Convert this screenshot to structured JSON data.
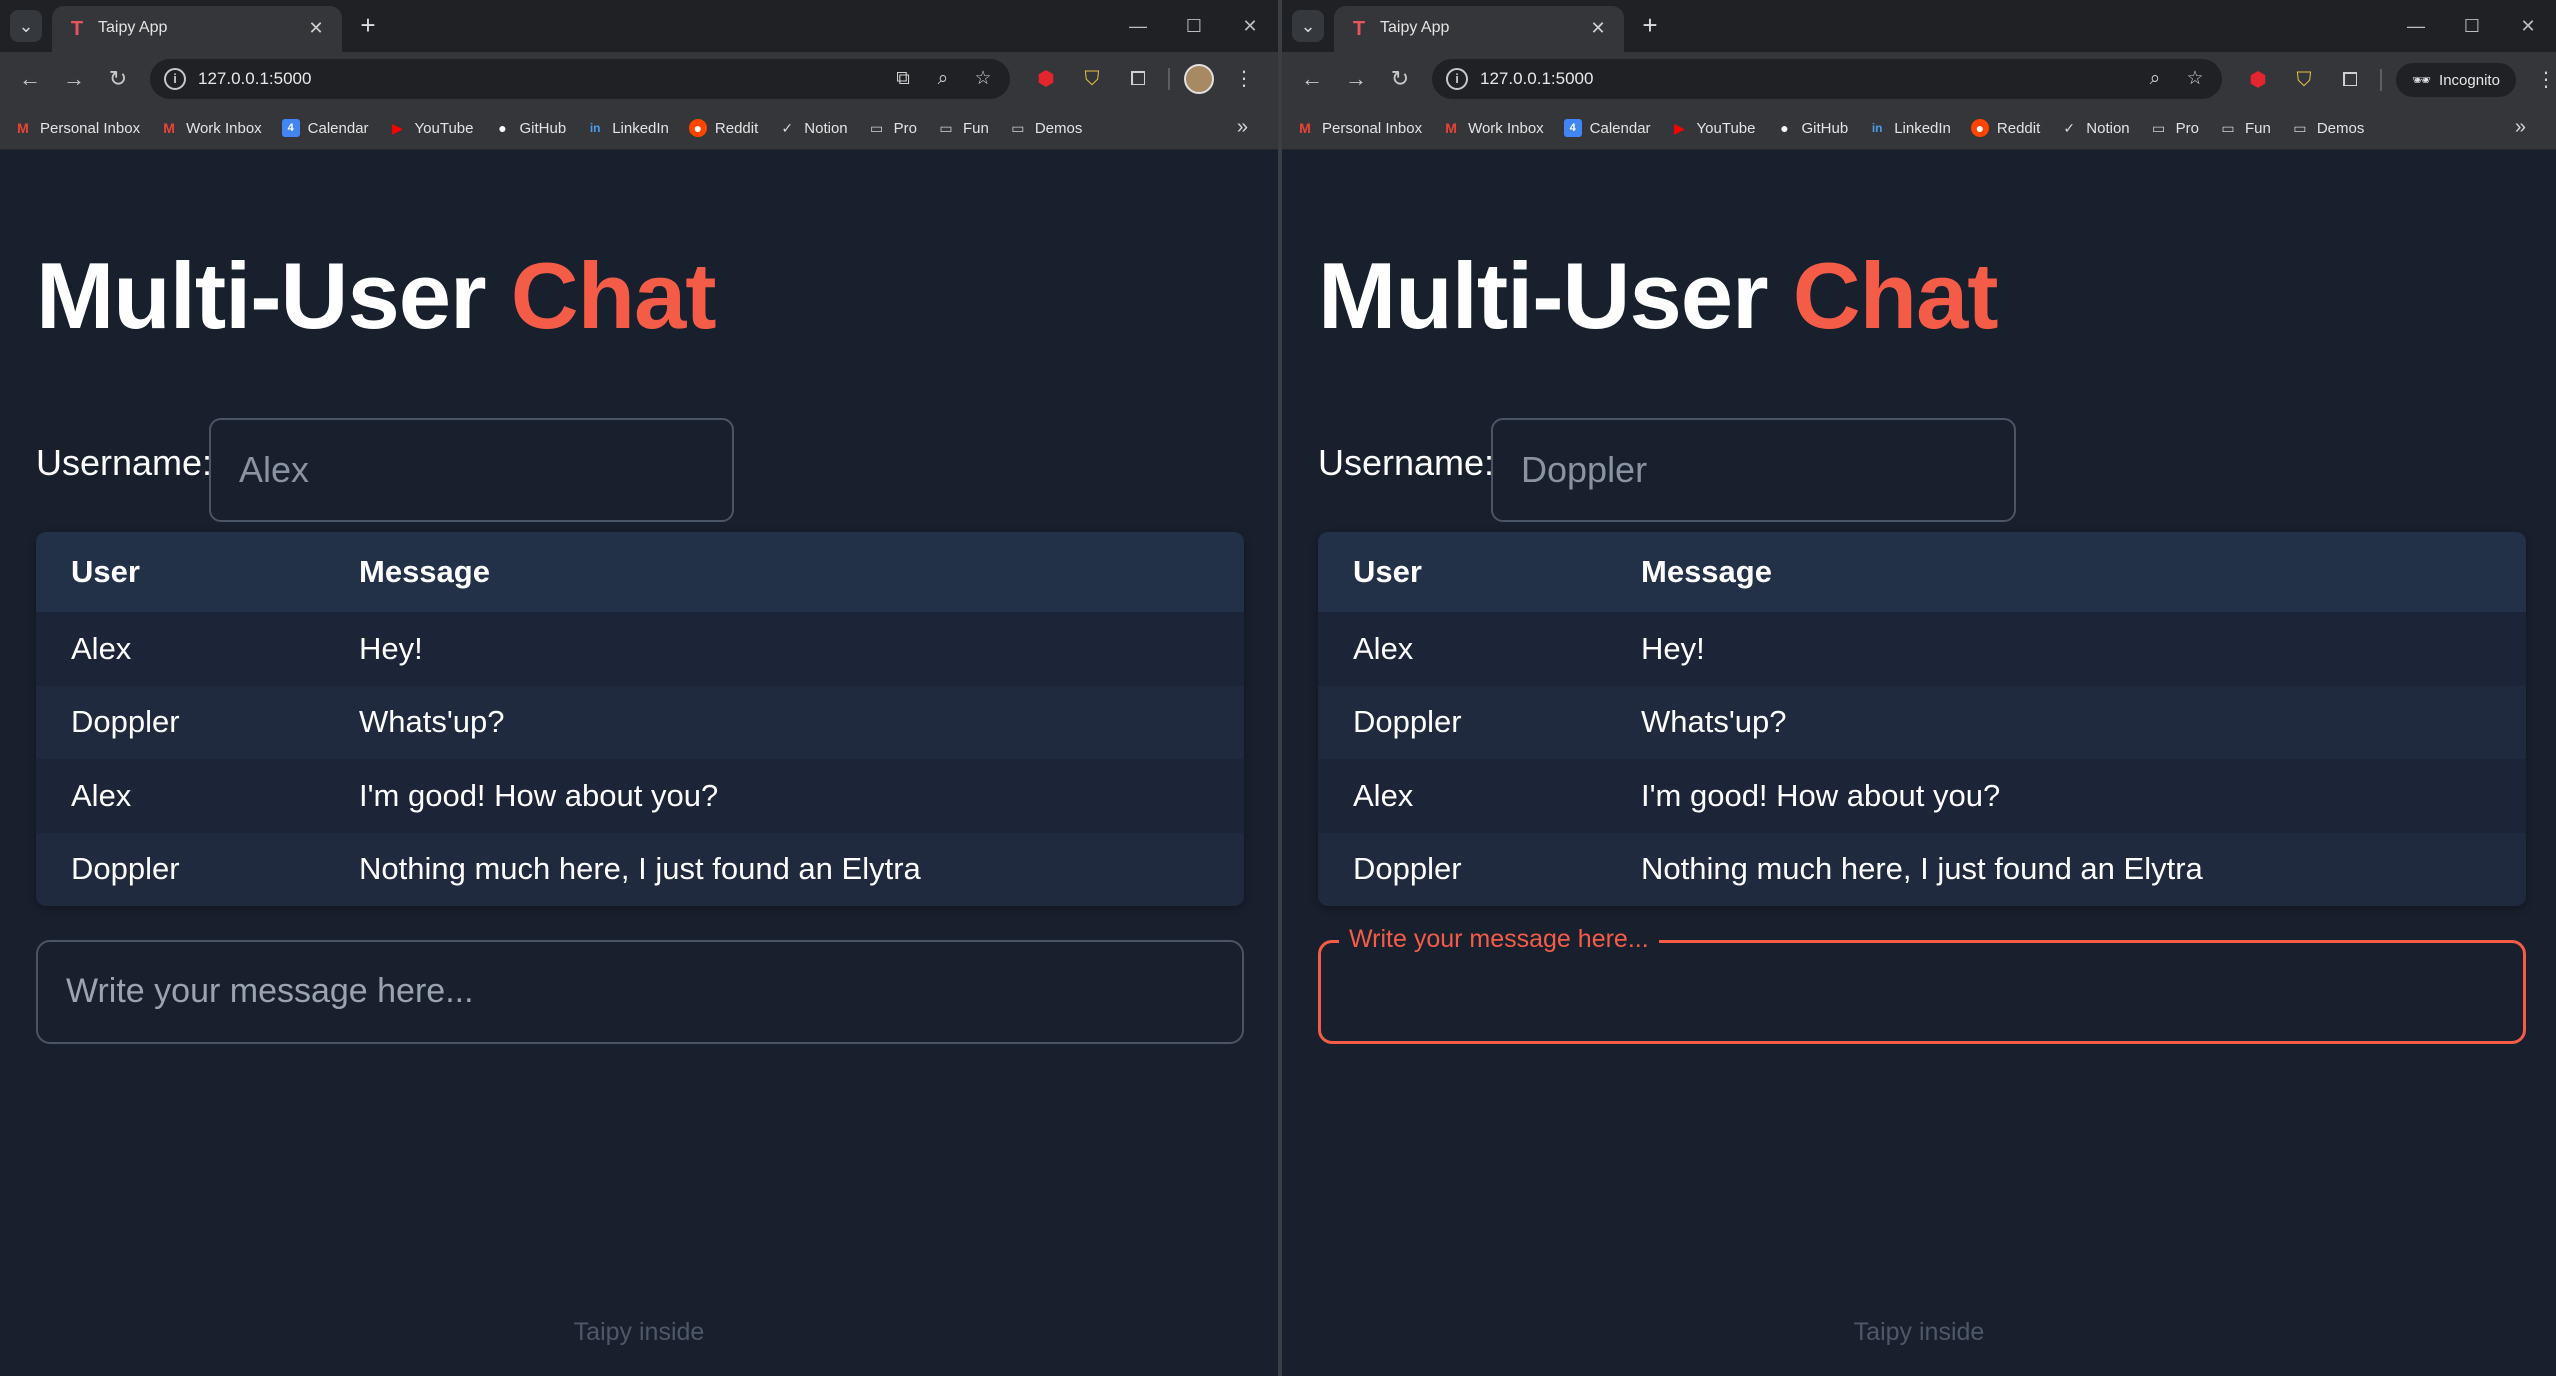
{
  "browser": {
    "tab_title": "Taipy App",
    "url": "127.0.0.1:5000",
    "incognito_label": "Incognito",
    "bookmarks": [
      {
        "label": "Personal Inbox",
        "icon": "gmail-icon"
      },
      {
        "label": "Work Inbox",
        "icon": "gmail-icon"
      },
      {
        "label": "Calendar",
        "icon": "calendar-icon"
      },
      {
        "label": "YouTube",
        "icon": "youtube-icon"
      },
      {
        "label": "GitHub",
        "icon": "github-icon"
      },
      {
        "label": "LinkedIn",
        "icon": "linkedin-icon"
      },
      {
        "label": "Reddit",
        "icon": "reddit-icon"
      },
      {
        "label": "Notion",
        "icon": "check-icon"
      },
      {
        "label": "Pro",
        "icon": "folder-icon"
      },
      {
        "label": "Fun",
        "icon": "folder-icon"
      },
      {
        "label": "Demos",
        "icon": "folder-icon"
      }
    ]
  },
  "app": {
    "title_main": "Multi-User",
    "title_accent": "Chat",
    "username_label": "Username:",
    "table_headers": {
      "user": "User",
      "message": "Message"
    },
    "messages": [
      {
        "user": "Alex",
        "message": "Hey!"
      },
      {
        "user": "Doppler",
        "message": "Whats'up?"
      },
      {
        "user": "Alex",
        "message": "I'm good! How about you?"
      },
      {
        "user": "Doppler",
        "message": "Nothing much here, I just found an Elytra"
      }
    ],
    "message_placeholder": "Write your message here...",
    "footer": "Taipy inside",
    "accent_color": "#f55c47",
    "background_color": "#18202e"
  },
  "left_window": {
    "username_value": "Alex"
  },
  "right_window": {
    "username_value": "Doppler"
  }
}
